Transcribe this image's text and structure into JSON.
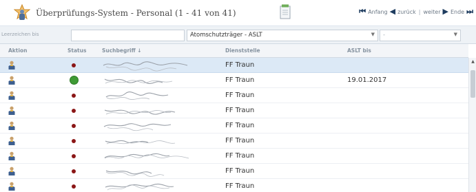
{
  "title": "Überprüfungs-System - Personal (1 - 41 von 41)",
  "pager": {
    "first": "Anfang",
    "prev": "zurück",
    "next": "weiter",
    "last": "Ende"
  },
  "filter": {
    "label": "Leerzeichen bis",
    "input_value": "",
    "category": "Atomschutzträger - ASLT",
    "value_select": "-"
  },
  "columns": {
    "aktion": "Aktion",
    "status": "Status",
    "suchbegriff": "Suchbegriff ↓",
    "dienststelle": "Dienststelle",
    "aslt_bis": "ASLT bis"
  },
  "rows": [
    {
      "status": "red",
      "dienststelle": "FF Traun",
      "aslt_bis": "",
      "selected": true
    },
    {
      "status": "green",
      "dienststelle": "FF Traun",
      "aslt_bis": "19.01.2017",
      "selected": false
    },
    {
      "status": "red",
      "dienststelle": "FF Traun",
      "aslt_bis": "",
      "selected": false
    },
    {
      "status": "red",
      "dienststelle": "FF Traun",
      "aslt_bis": "",
      "selected": false
    },
    {
      "status": "red",
      "dienststelle": "FF Traun",
      "aslt_bis": "",
      "selected": false
    },
    {
      "status": "red",
      "dienststelle": "FF Traun",
      "aslt_bis": "",
      "selected": false
    },
    {
      "status": "red",
      "dienststelle": "FF Traun",
      "aslt_bis": "",
      "selected": false
    },
    {
      "status": "red",
      "dienststelle": "FF Traun",
      "aslt_bis": "",
      "selected": false
    },
    {
      "status": "red",
      "dienststelle": "FF Traun",
      "aslt_bis": "",
      "selected": false
    }
  ],
  "icons": {
    "app": "badge-person-icon",
    "export": "export-document-icon",
    "action": "person-icon",
    "status_ok": "green-dot",
    "status_fail": "red-dot"
  },
  "colors": {
    "status_red": "#8b1717",
    "status_green": "#3e9a35",
    "selected_row": "#dce9f6",
    "header_text": "#8693a0"
  }
}
